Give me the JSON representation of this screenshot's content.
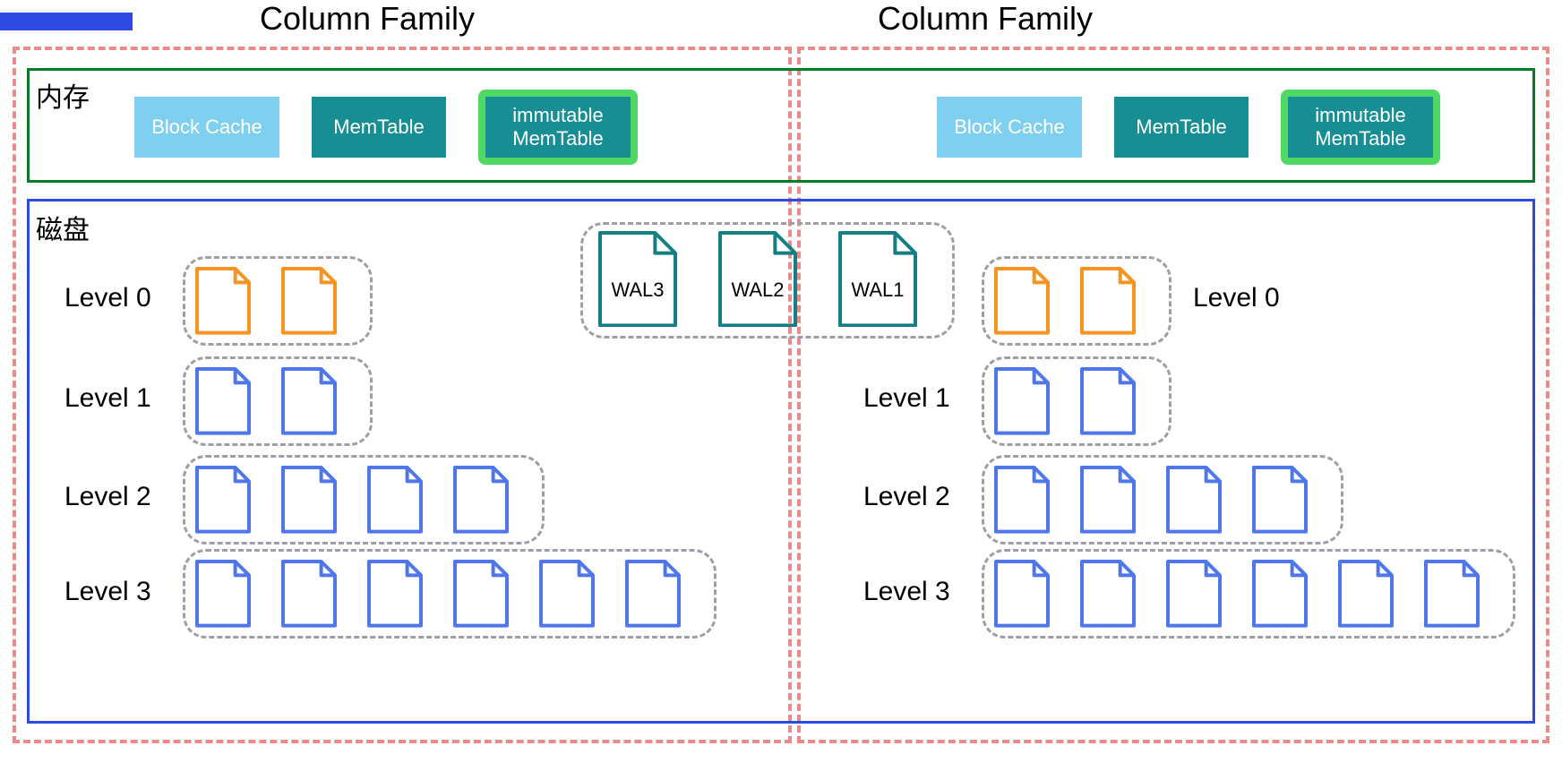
{
  "colors": {
    "orange": "#f59323",
    "blue": "#4f77eb",
    "teal": "#137f82",
    "lightblue": "#7fd0f0",
    "tealfill": "#168e94",
    "green": "#4fd964",
    "red": "#e98b8b",
    "gray": "#9aa0a6"
  },
  "bar_color": "#2d4be0",
  "titles": {
    "cf_left": "Column Family",
    "cf_right": "Column Family"
  },
  "memory": {
    "label": "内存",
    "block_cache": "Block Cache",
    "memtable": "MemTable",
    "immutable": "immutable\nMemTable"
  },
  "disk": {
    "label": "磁盘",
    "levels": [
      "Level 0",
      "Level 1",
      "Level 2",
      "Level 3"
    ],
    "level_file_counts": [
      2,
      2,
      4,
      6
    ],
    "level_file_colors": [
      "orange",
      "blue",
      "blue",
      "blue"
    ]
  },
  "wal": {
    "items": [
      "WAL3",
      "WAL2",
      "WAL1"
    ]
  },
  "columns": [
    {
      "side": "left",
      "level0_label_side": "left"
    },
    {
      "side": "right",
      "level0_label_side": "right"
    }
  ]
}
